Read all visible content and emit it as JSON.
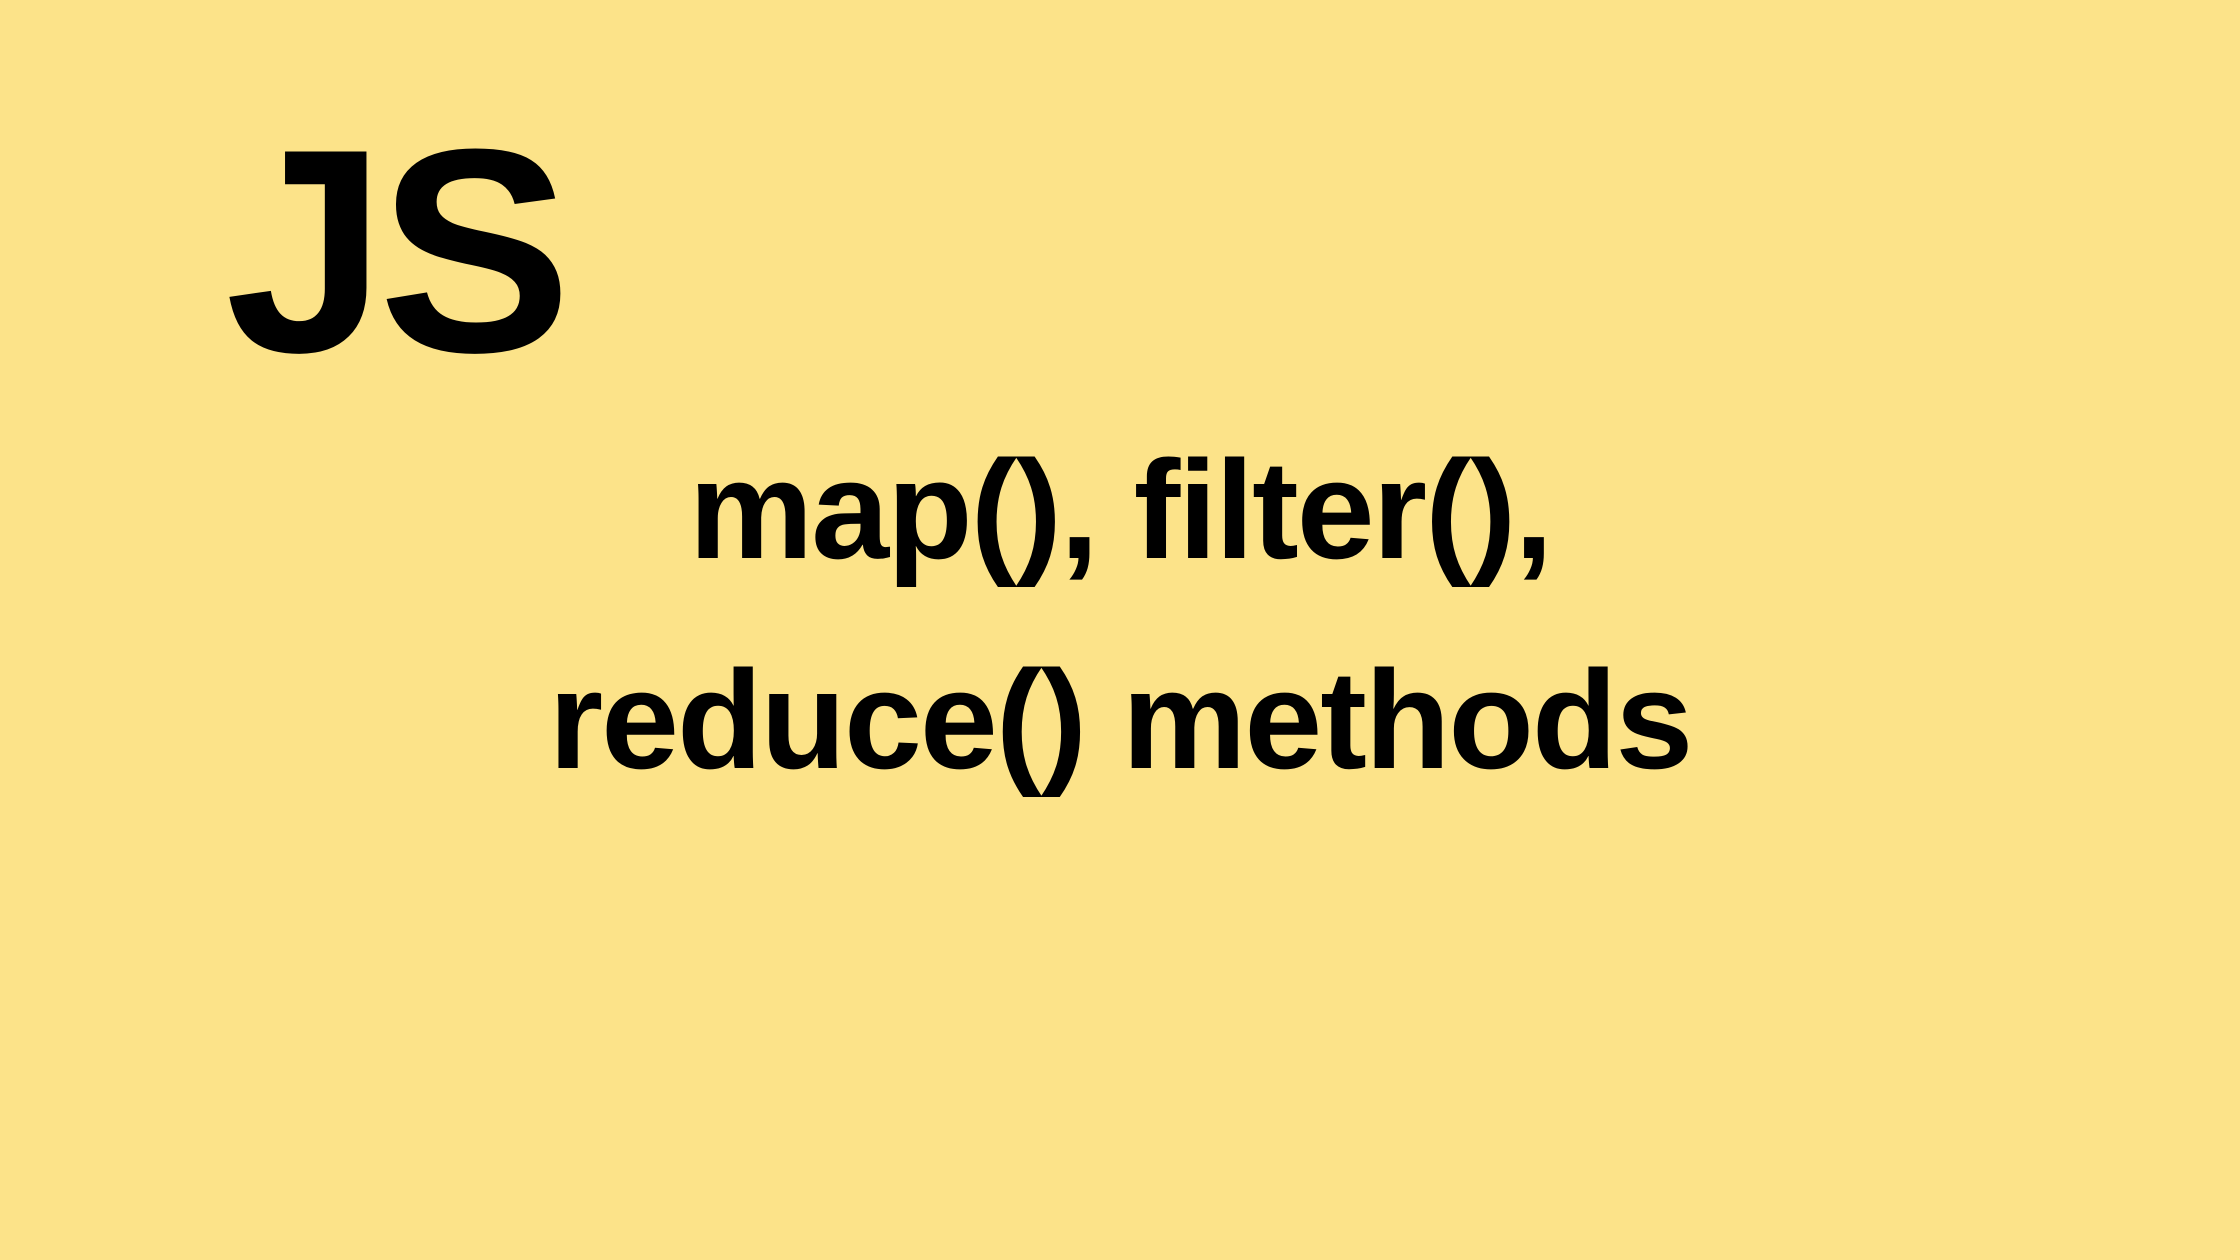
{
  "title": {
    "label": "JS"
  },
  "subtitle": {
    "line1": "map(), filter(),",
    "line2": "reduce() methods"
  },
  "colors": {
    "background": "#fce389",
    "text": "#000000"
  }
}
